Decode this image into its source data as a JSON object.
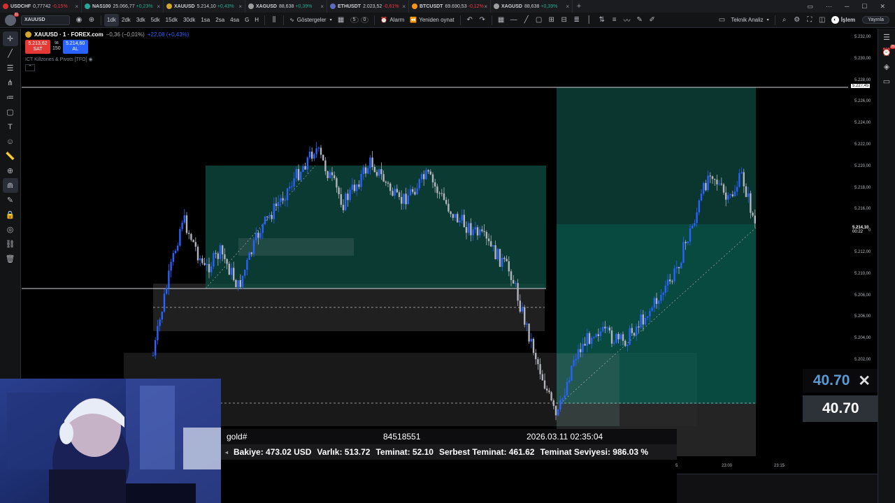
{
  "tabs": [
    {
      "symbol": "USDCHF",
      "price": "0,77742",
      "change": "-0,15%",
      "dot": "#d32f2f",
      "change_color": "#f23645"
    },
    {
      "symbol": "NAS100",
      "price": "25.066,77",
      "change": "+0,23%",
      "dot": "#26a69a",
      "change_color": "#22ab94"
    },
    {
      "symbol": "XAUUSD",
      "price": "5.214,10",
      "change": "+0,43%",
      "dot": "#d4a72c",
      "change_color": "#22ab94"
    },
    {
      "symbol": "XAGUSD",
      "price": "88,638",
      "change": "+0,39%",
      "dot": "#9e9e9e",
      "change_color": "#22ab94"
    },
    {
      "symbol": "ETHUSDT",
      "price": "2.023,52",
      "change": "-0,61%",
      "dot": "#5c6bc0",
      "change_color": "#f23645"
    },
    {
      "symbol": "BTCUSDT",
      "price": "69.690,53",
      "change": "-0,12%",
      "dot": "#f7931a",
      "change_color": "#f23645"
    },
    {
      "symbol": "XAGUSD",
      "price": "88,638",
      "change": "+0,39%",
      "dot": "#9e9e9e",
      "change_color": "#22ab94"
    }
  ],
  "toolbar": {
    "avatar_badge": "11",
    "symbol": "XAUUSD",
    "intervals": [
      "1dk",
      "2dk",
      "3dk",
      "5dk",
      "15dk",
      "30dk",
      "1sa",
      "2sa",
      "4sa",
      "G",
      "H"
    ],
    "active_interval": "1dk",
    "indicators_label": "Göstergeler",
    "counter1": "5",
    "counter2": "0",
    "alarm_label": "Alarm",
    "replay_label": "Yeniden oynat",
    "analysis_label": "Teknik Analiz",
    "trade_label": "İşlem",
    "publish_label": "Yayınla"
  },
  "legend": {
    "title": "XAUUSD · 1 · FOREX.com",
    "change_neg": "−0,36 (−0,01%)",
    "change_pos": "+22,08 (+0,43%)",
    "sell_price": "5.213,62",
    "sell_label": "SAT",
    "spread_top": "98",
    "spread_bottom": "150",
    "buy_price": "5.214,60",
    "buy_label": "AL",
    "indicator": "ICT Killzones & Pivots [TFO]"
  },
  "right_panel": {
    "badge": "26"
  },
  "price_axis": {
    "labels": [
      "5.232,00",
      "5.230,00",
      "5.228,00",
      "5.226,00",
      "5.224,00",
      "5.222,00",
      "5.220,00",
      "5.218,00",
      "5.216,00",
      "5.214,00",
      "5.212,00",
      "5.210,00",
      "5.208,00",
      "5.206,00",
      "5.204,00",
      "5.202,00"
    ],
    "highlight_price": "5.227,45",
    "current_price": "5.214,10",
    "countdown": "00:22"
  },
  "time_axis": [
    "5",
    "23:00",
    "23:15"
  ],
  "mt_panel": {
    "symbol": "gold#",
    "ticket": "84518551",
    "datetime": "2026.03.11 02:35:04",
    "balance": "Bakiye: 473.02 USD",
    "equity": "Varlık: 513.72",
    "margin": "Teminat: 52.10",
    "free_margin": "Serbest Teminat: 461.62",
    "margin_level": "Teminat Seviyesi: 986.03 %"
  },
  "overlay": {
    "value_top": "40.70",
    "value_bottom": "40.70"
  },
  "colors": {
    "bull": "#2962ff",
    "bear": "#b2b5be",
    "zone": "#0f4d44",
    "grey_zone": "#2e2e2e"
  }
}
